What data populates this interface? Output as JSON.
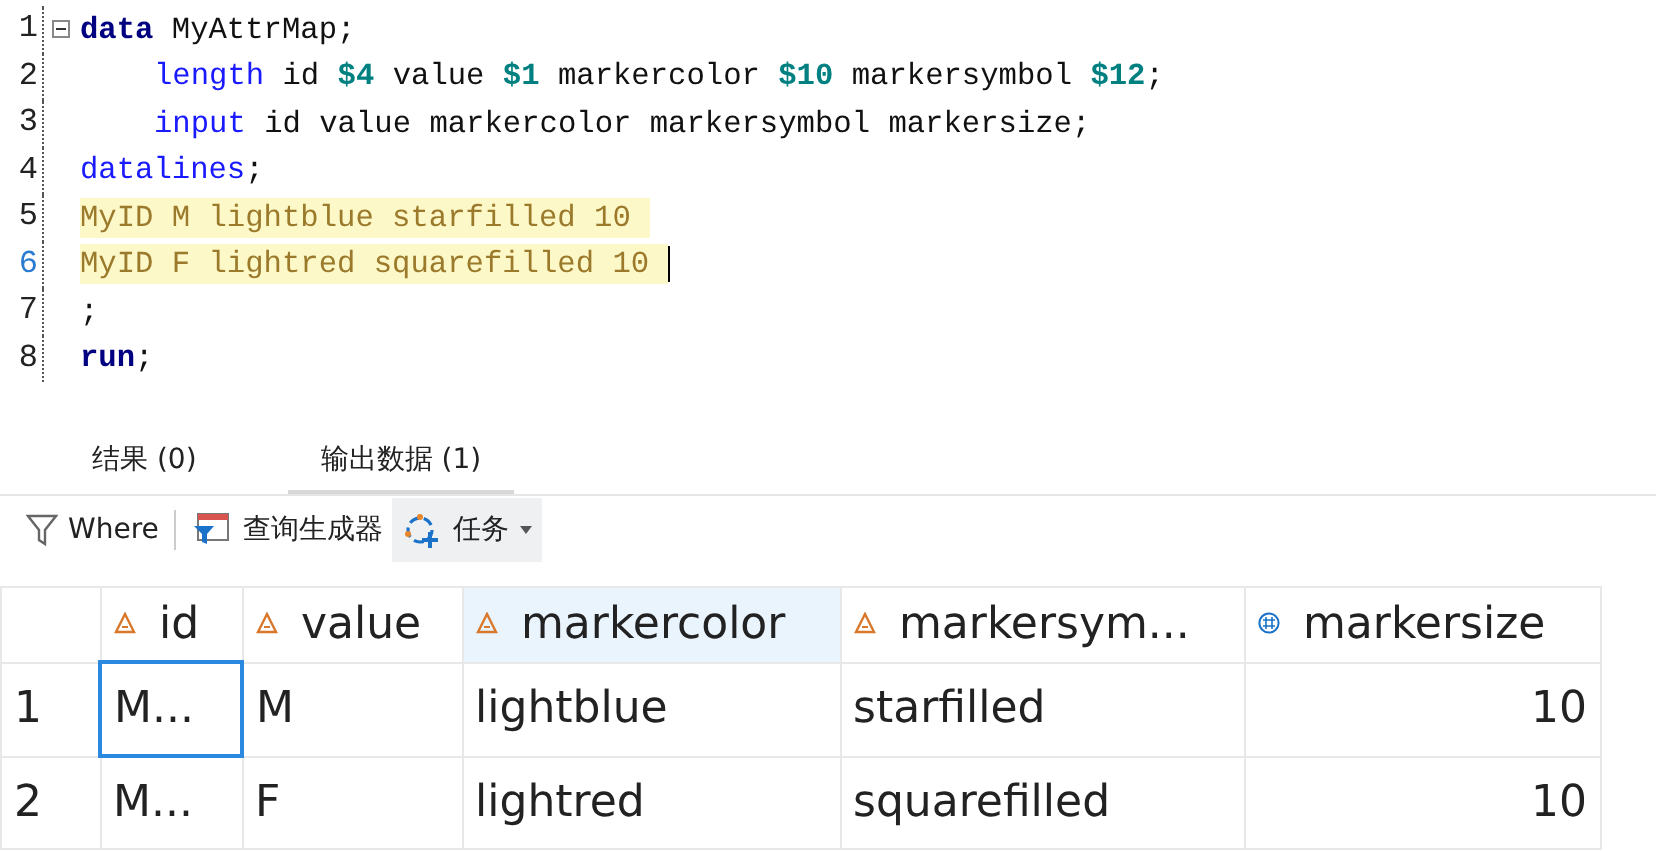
{
  "editor": {
    "lines": [
      {
        "number": "1",
        "fold": true,
        "highlighted": false,
        "current": false,
        "cursor": false,
        "tokens": [
          {
            "kind": "keyword-bold",
            "text": "data"
          },
          {
            "kind": "plain",
            "text": " MyAttrMap;"
          }
        ]
      },
      {
        "number": "2",
        "fold": false,
        "highlighted": false,
        "current": false,
        "cursor": false,
        "indented": true,
        "tokens": [
          {
            "kind": "keyword",
            "text": "length"
          },
          {
            "kind": "plain",
            "text": " id "
          },
          {
            "kind": "number",
            "text": "$4"
          },
          {
            "kind": "plain",
            "text": " value "
          },
          {
            "kind": "number",
            "text": "$1"
          },
          {
            "kind": "plain",
            "text": " markercolor "
          },
          {
            "kind": "number",
            "text": "$10"
          },
          {
            "kind": "plain",
            "text": " markersymbol "
          },
          {
            "kind": "number",
            "text": "$12"
          },
          {
            "kind": "plain",
            "text": ";"
          }
        ]
      },
      {
        "number": "3",
        "fold": false,
        "highlighted": false,
        "current": false,
        "cursor": false,
        "indented": true,
        "tokens": [
          {
            "kind": "keyword",
            "text": "input"
          },
          {
            "kind": "plain",
            "text": " id value markercolor markersymbol markersize;"
          }
        ]
      },
      {
        "number": "4",
        "fold": false,
        "highlighted": false,
        "current": false,
        "cursor": false,
        "tokens": [
          {
            "kind": "keyword",
            "text": "datalines"
          },
          {
            "kind": "plain",
            "text": ";"
          }
        ]
      },
      {
        "number": "5",
        "fold": false,
        "highlighted": true,
        "current": false,
        "cursor": false,
        "tokens": [
          {
            "kind": "data",
            "text": "MyID M lightblue starfilled 10 "
          }
        ]
      },
      {
        "number": "6",
        "fold": false,
        "highlighted": true,
        "current": true,
        "cursor": true,
        "tokens": [
          {
            "kind": "data",
            "text": "MyID F lightred squarefilled 10 "
          }
        ]
      },
      {
        "number": "7",
        "fold": false,
        "highlighted": false,
        "current": false,
        "cursor": false,
        "tokens": [
          {
            "kind": "plain",
            "text": ";"
          }
        ]
      },
      {
        "number": "8",
        "fold": false,
        "highlighted": false,
        "current": false,
        "cursor": false,
        "tokens": [
          {
            "kind": "keyword-bold",
            "text": "run"
          },
          {
            "kind": "plain",
            "text": ";"
          }
        ]
      }
    ]
  },
  "tabs": [
    {
      "label": "结果 (0)",
      "selected": false
    },
    {
      "label": "输出数据 (1)",
      "selected": true
    }
  ],
  "toolbar": [
    {
      "kind": "filter",
      "label": "Where"
    },
    {
      "kind": "separator"
    },
    {
      "kind": "query",
      "label": "查询生成器"
    },
    {
      "kind": "tasks",
      "label": "任务",
      "hovered": true
    }
  ],
  "table": {
    "columns": [
      {
        "label": "id",
        "kind": "char",
        "selected": false
      },
      {
        "label": "value",
        "kind": "char",
        "selected": false
      },
      {
        "label": "markercolor",
        "kind": "char",
        "selected": true
      },
      {
        "label": "markersym...",
        "kind": "char",
        "selected": false
      },
      {
        "label": "markersize",
        "kind": "num",
        "selected": false
      }
    ],
    "rows": [
      {
        "number": "1",
        "cells": [
          {
            "text": "M...",
            "focused": true
          },
          {
            "text": "M",
            "focused": false
          },
          {
            "text": "lightblue",
            "focused": false
          },
          {
            "text": "starfilled",
            "focused": false
          },
          {
            "text": "10",
            "focused": false
          }
        ]
      },
      {
        "number": "2",
        "cells": [
          {
            "text": "M...",
            "focused": false
          },
          {
            "text": "F",
            "focused": false
          },
          {
            "text": "lightred",
            "focused": false
          },
          {
            "text": "squarefilled",
            "focused": false
          },
          {
            "text": "10",
            "focused": false
          }
        ]
      }
    ]
  }
}
